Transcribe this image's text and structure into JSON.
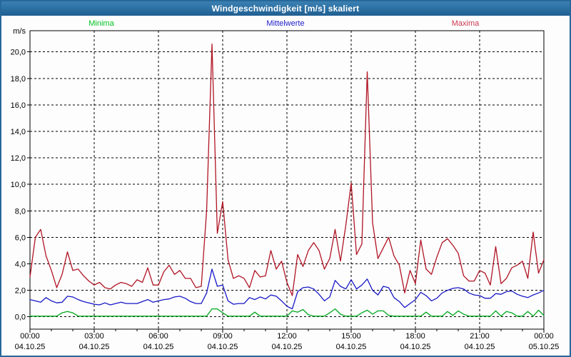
{
  "window": {
    "title": "Windgeschwindigkeit [m/s] skaliert",
    "title_bar_color": "#2d6f9f",
    "border_color": "#26689a"
  },
  "legend": {
    "minima": {
      "label": "Minima",
      "color": "#00c01e"
    },
    "mittelwerte": {
      "label": "Mittelwerte",
      "color": "#2020cc"
    },
    "maxima": {
      "label": "Maxima",
      "color": "#cc3850"
    }
  },
  "chart_data": {
    "type": "line",
    "title": "Windgeschwindigkeit [m/s] skaliert",
    "grid": true,
    "legend_position": "top",
    "ylim": [
      -0.9,
      21.6
    ],
    "y_axis": {
      "unit_label": "m/s",
      "tick_labels": [
        "20,0",
        "18,0",
        "16,0",
        "14,0",
        "12,0",
        "10,0",
        "8,0",
        "6,0",
        "4,0",
        "2,0",
        "0,0"
      ],
      "tick_values": [
        20,
        18,
        16,
        14,
        12,
        10,
        8,
        6,
        4,
        2,
        0
      ]
    },
    "x_axis": {
      "hours_total": 24,
      "minor_tick_every_hours": 1,
      "major_ticks": [
        {
          "time": "00:00",
          "date": "04.10.25"
        },
        {
          "time": "03:00",
          "date": "04.10.25"
        },
        {
          "time": "06:00",
          "date": "04.10.25"
        },
        {
          "time": "09:00",
          "date": "04.10.25"
        },
        {
          "time": "12:00",
          "date": "04.10.25"
        },
        {
          "time": "15:00",
          "date": "04.10.25"
        },
        {
          "time": "18:00",
          "date": "04.10.25"
        },
        {
          "time": "21:00",
          "date": "04.10.25"
        },
        {
          "time": "00:00",
          "date": "05.10.25"
        }
      ]
    },
    "time_start": "00:00",
    "time_step_minutes": 15,
    "series": [
      {
        "name": "Maxima",
        "color": "#b01424",
        "values": [
          3.0,
          6.0,
          6.6,
          4.6,
          3.5,
          2.2,
          3.2,
          4.9,
          3.5,
          3.6,
          3.1,
          2.7,
          2.4,
          2.6,
          2.2,
          2.1,
          2.4,
          2.6,
          2.5,
          2.3,
          2.8,
          2.6,
          3.7,
          2.4,
          2.4,
          3.4,
          3.9,
          3.2,
          3.5,
          2.9,
          2.9,
          2.2,
          2.3,
          8.0,
          20.6,
          6.3,
          8.7,
          4.3,
          2.9,
          3.1,
          2.9,
          2.2,
          3.5,
          3.0,
          3.1,
          5.0,
          3.6,
          4.2,
          2.6,
          1.6,
          4.7,
          3.8,
          5.0,
          5.6,
          5.0,
          3.6,
          4.4,
          6.6,
          4.2,
          6.9,
          10.1,
          4.7,
          5.5,
          18.5,
          7.1,
          4.4,
          5.2,
          6.0,
          4.6,
          3.9,
          1.8,
          3.5,
          2.5,
          5.8,
          3.6,
          3.2,
          4.5,
          5.6,
          5.9,
          5.4,
          4.8,
          3.1,
          2.7,
          2.7,
          3.5,
          3.3,
          2.4,
          5.3,
          2.5,
          2.9,
          3.7,
          3.9,
          4.2,
          2.9,
          6.4,
          3.3,
          4.3
        ]
      },
      {
        "name": "Mittelwerte",
        "color": "#1818c8",
        "values": [
          1.3,
          1.2,
          1.1,
          1.45,
          1.2,
          1.05,
          1.1,
          1.55,
          1.5,
          1.3,
          1.15,
          1.05,
          0.95,
          0.9,
          1.05,
          0.9,
          1.0,
          1.1,
          1.0,
          1.0,
          1.0,
          1.15,
          1.3,
          1.1,
          1.2,
          1.3,
          1.35,
          1.5,
          1.55,
          1.4,
          1.15,
          1.0,
          1.0,
          1.8,
          3.6,
          2.3,
          2.4,
          1.2,
          0.95,
          1.0,
          1.0,
          1.45,
          1.3,
          1.5,
          1.35,
          1.65,
          1.55,
          1.2,
          0.8,
          0.6,
          1.9,
          2.2,
          2.25,
          2.1,
          1.7,
          1.2,
          1.5,
          2.75,
          2.3,
          2.1,
          2.8,
          2.1,
          2.4,
          2.85,
          2.0,
          1.65,
          2.3,
          2.2,
          1.45,
          1.15,
          0.7,
          1.0,
          1.3,
          1.85,
          1.6,
          1.2,
          1.4,
          1.8,
          2.0,
          2.15,
          2.2,
          2.1,
          1.8,
          1.65,
          1.6,
          1.4,
          1.4,
          1.75,
          1.7,
          1.9,
          1.95,
          1.7,
          1.55,
          1.45,
          1.65,
          1.8,
          2.0
        ]
      },
      {
        "name": "Minima",
        "color": "#00a81e",
        "values": [
          0.05,
          0.05,
          0.05,
          0.05,
          0.05,
          0.05,
          0.3,
          0.4,
          0.3,
          0.05,
          0.05,
          0.05,
          0.05,
          0.05,
          0.05,
          0.05,
          0.05,
          0.05,
          0.05,
          0.05,
          0.05,
          0.05,
          0.05,
          0.05,
          0.05,
          0.05,
          0.05,
          0.05,
          0.05,
          0.05,
          0.05,
          0.05,
          0.05,
          0.05,
          0.6,
          0.6,
          0.3,
          0.05,
          0.05,
          0.05,
          0.05,
          0.05,
          0.35,
          0.05,
          0.05,
          0.05,
          0.05,
          0.05,
          0.05,
          0.45,
          0.35,
          0.55,
          0.15,
          0.05,
          0.05,
          0.05,
          0.3,
          0.6,
          0.2,
          0.05,
          0.05,
          0.05,
          0.3,
          0.5,
          0.2,
          0.45,
          0.45,
          0.1,
          0.05,
          0.05,
          0.05,
          0.05,
          0.05,
          0.05,
          0.35,
          0.05,
          0.05,
          0.05,
          0.4,
          0.1,
          0.45,
          0.2,
          0.05,
          0.05,
          0.05,
          0.05,
          0.05,
          0.45,
          0.05,
          0.4,
          0.3,
          0.05,
          0.05,
          0.4,
          0.05,
          0.5,
          0.1
        ]
      }
    ]
  }
}
